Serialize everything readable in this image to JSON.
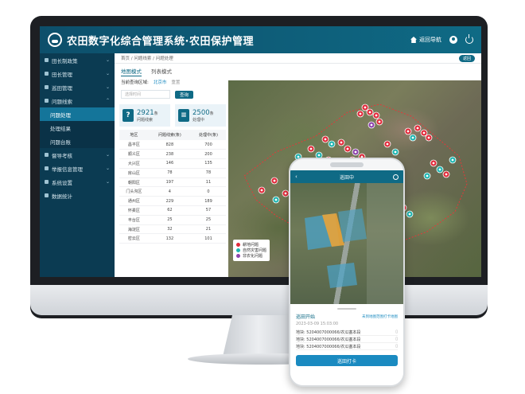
{
  "app": {
    "title": "农田数字化综合管理系统·农田保护管理",
    "nav_home": "返回导航"
  },
  "sidebar": {
    "items": [
      {
        "label": "田长制政策"
      },
      {
        "label": "田长管理"
      },
      {
        "label": "巡田管理"
      },
      {
        "label": "问题线索"
      },
      {
        "label": "督导考核"
      },
      {
        "label": "举报信息管理"
      },
      {
        "label": "系统设置"
      },
      {
        "label": "数据统计"
      }
    ],
    "sub_items": [
      {
        "label": "问题处理"
      },
      {
        "label": "处理结果"
      },
      {
        "label": "问题台账"
      }
    ]
  },
  "main": {
    "breadcrumb": "首页 / 问题线索 / 问题处理",
    "back_label": "返回",
    "tabs": [
      {
        "label": "地图模式"
      },
      {
        "label": "列表模式"
      }
    ],
    "filter_label": "当前查询区域:",
    "filter_value": "北京市",
    "reset_label": "重置",
    "search_placeholder": "选择时间",
    "query_label": "查询",
    "stats": [
      {
        "icon": "?",
        "value": "2921",
        "unit": "条",
        "label": "问题线索"
      },
      {
        "icon": "≡",
        "value": "2500",
        "unit": "条",
        "label": "处理中"
      }
    ],
    "table": {
      "headers": [
        "地区",
        "问题线索(条)",
        "处理中(条)"
      ],
      "rows": [
        [
          "昌平区",
          "828",
          "700"
        ],
        [
          "顺义区",
          "238",
          "200"
        ],
        [
          "大兴区",
          "146",
          "135"
        ],
        [
          "房山区",
          "78",
          "78"
        ],
        [
          "朝阳区",
          "197",
          "11"
        ],
        [
          "门头沟区",
          "4",
          "0"
        ],
        [
          "通州区",
          "229",
          "189"
        ],
        [
          "怀柔区",
          "62",
          "57"
        ],
        [
          "丰台区",
          "25",
          "25"
        ],
        [
          "海淀区",
          "32",
          "21"
        ],
        [
          "密云区",
          "132",
          "101"
        ]
      ]
    },
    "legend": [
      {
        "label": "耕地问题",
        "color": "#e02a3a"
      },
      {
        "label": "自然灾害问题",
        "color": "#1fb5b0"
      },
      {
        "label": "非农化问题",
        "color": "#8e44ad"
      }
    ]
  },
  "phone": {
    "title": "巡田中",
    "sheet_title": "巡田开始",
    "sheet_link": "未到地图范围打卡地图",
    "date": "2023-03-09 15:03:00",
    "plots": [
      {
        "label": "地块: 5204007000066/农瓜塞本段"
      },
      {
        "label": "地块: 5204007000066/农瓜塞本段"
      },
      {
        "label": "地块: 5204007000066/农瓜塞本段"
      }
    ],
    "button_label": "巡田打卡"
  }
}
